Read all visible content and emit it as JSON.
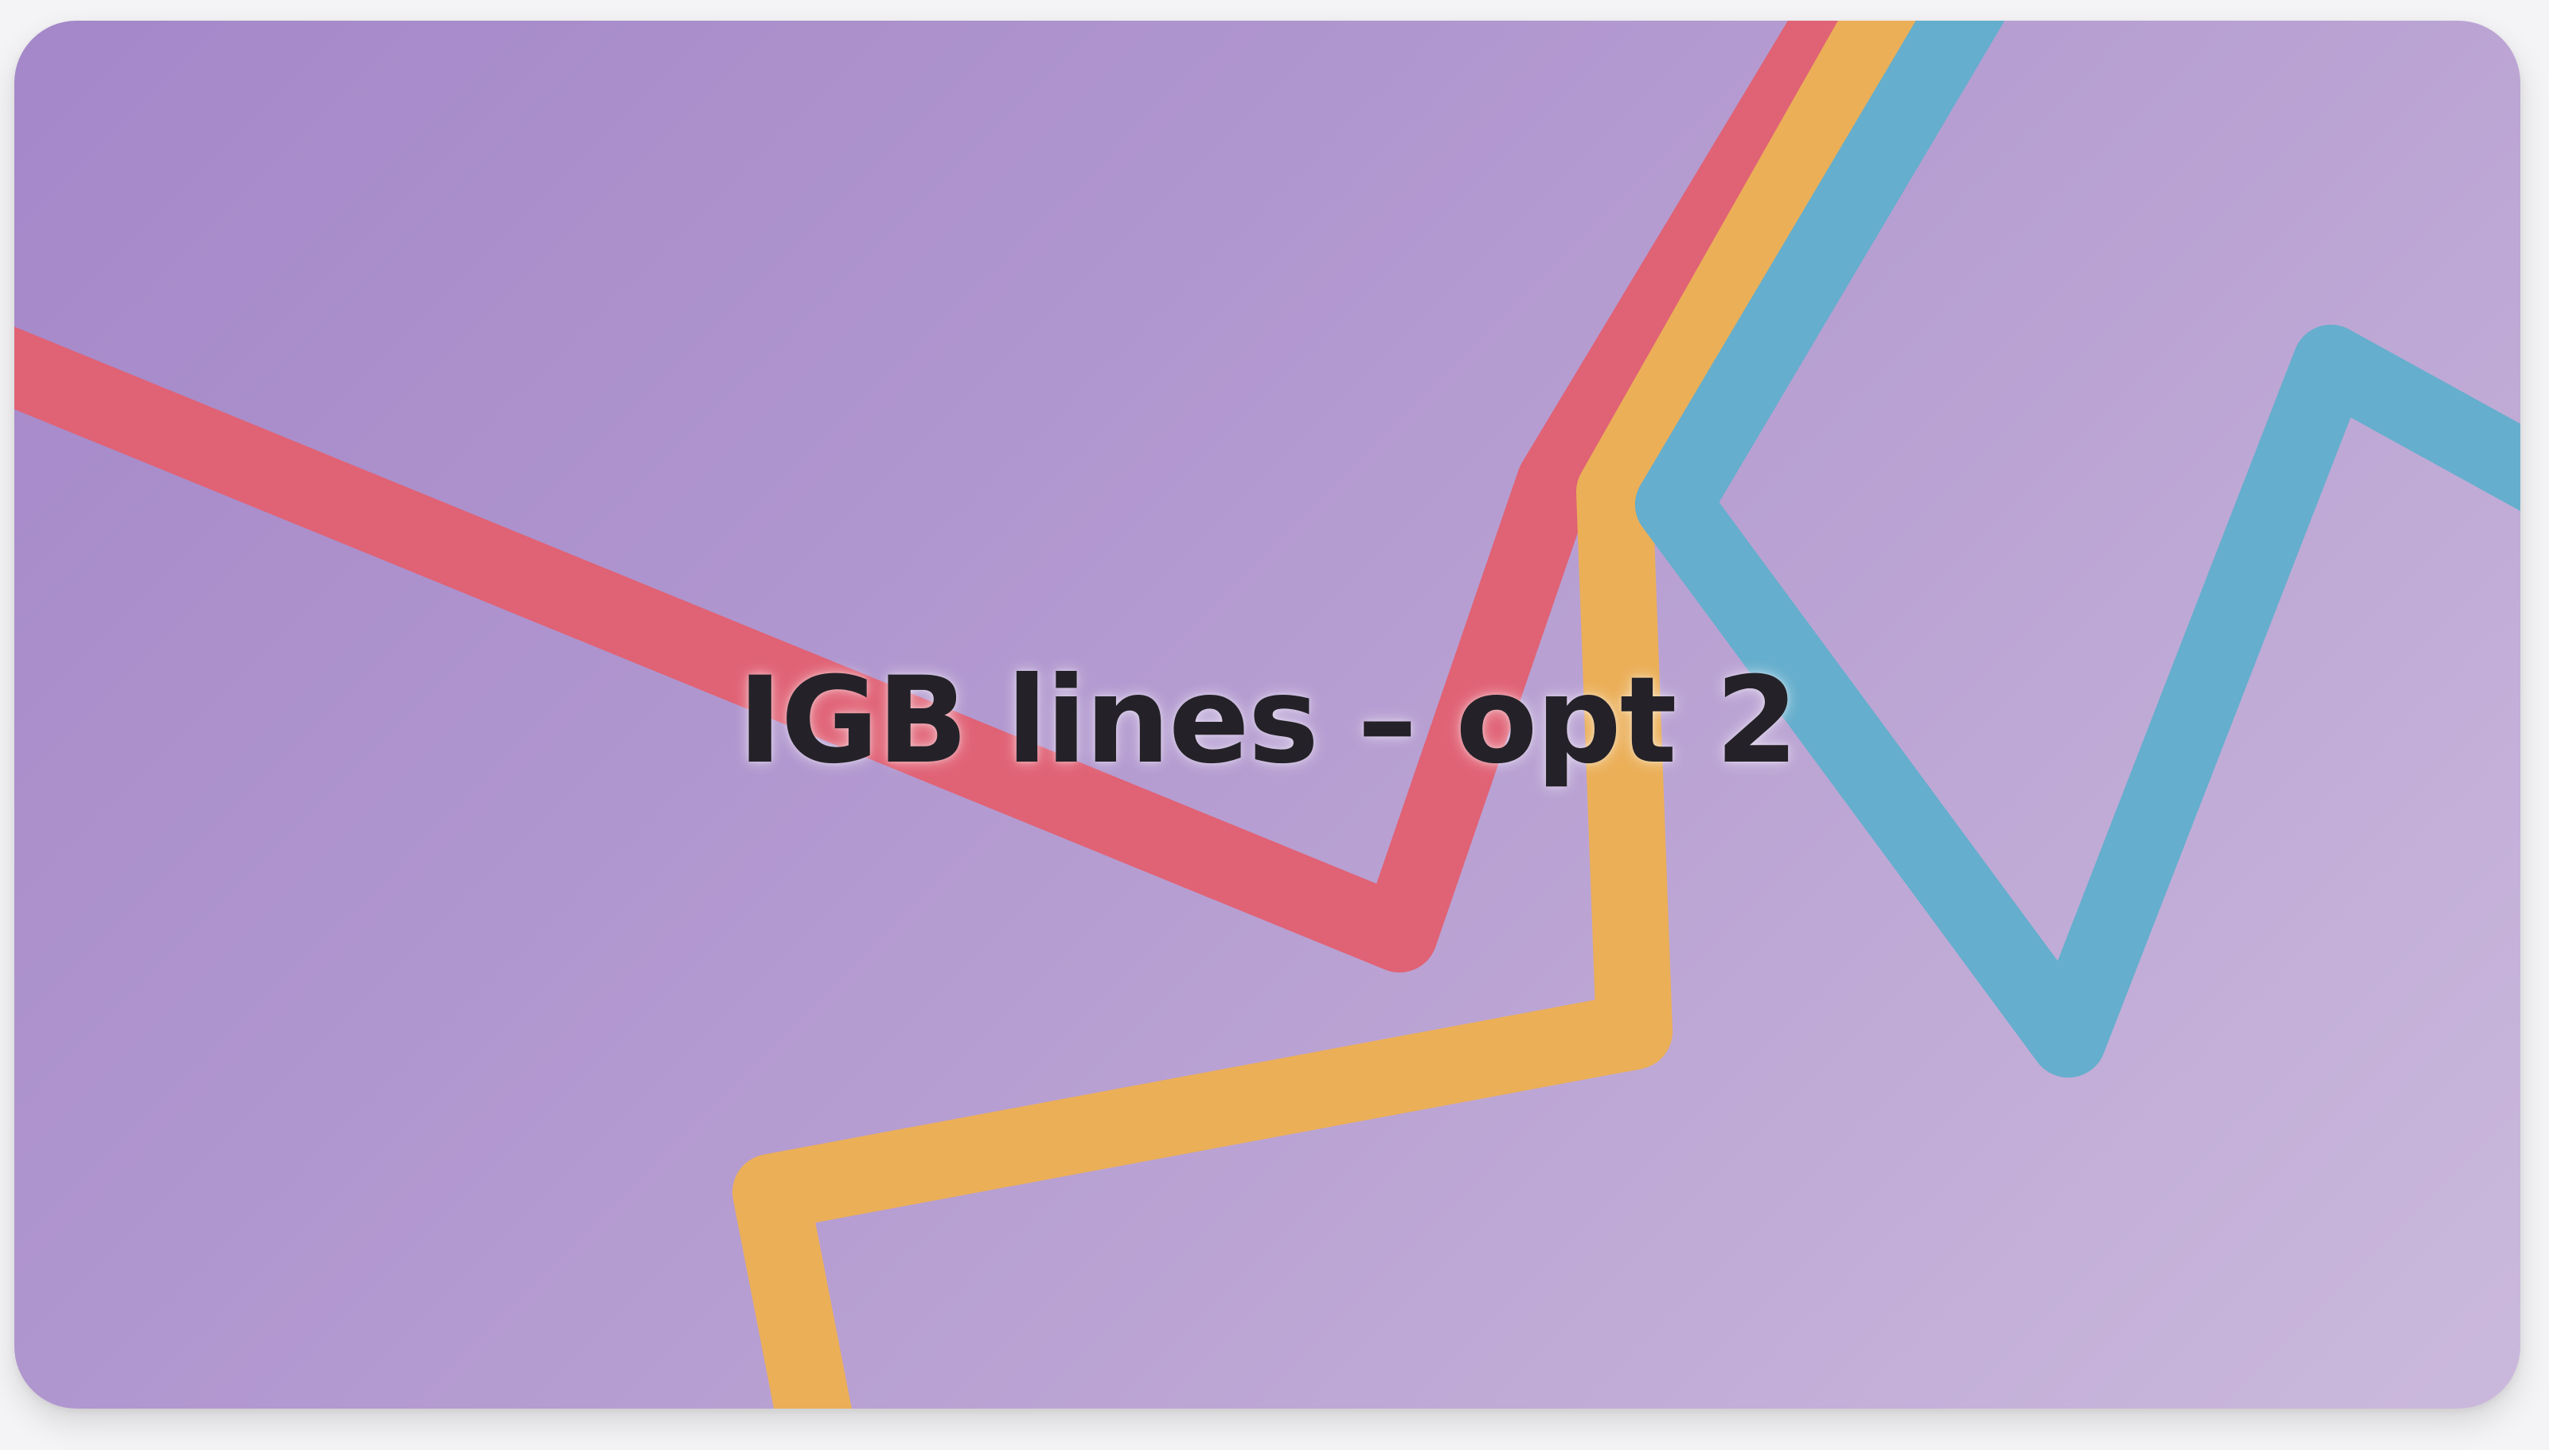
{
  "title": "IGB lines – opt 2",
  "colors": {
    "red_line": "#e06275",
    "orange_line": "#ebaf58",
    "blue_line": "#65aecd",
    "title_text": "#242228",
    "gradient_start": "#a487c9",
    "gradient_end": "#cbb9dc"
  },
  "decorations": [
    "red-line",
    "orange-line",
    "blue-line"
  ]
}
